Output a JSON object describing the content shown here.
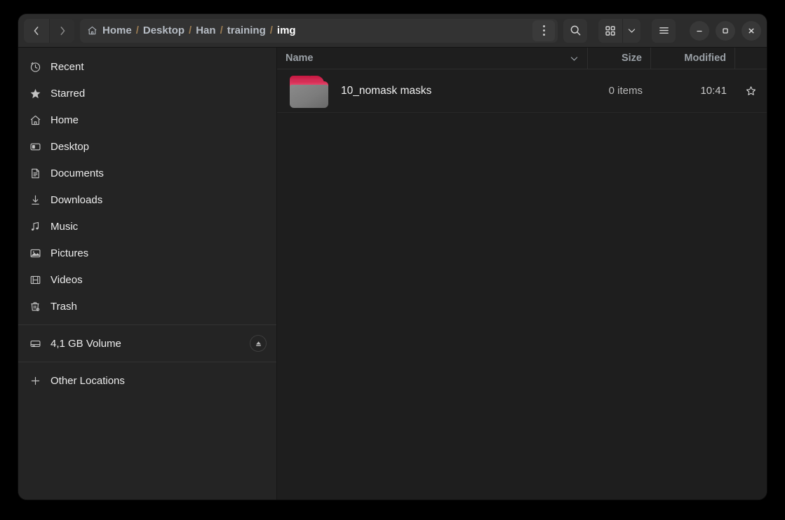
{
  "window": {
    "nav": {
      "back_label": "Back",
      "forward_label": "Forward"
    },
    "pathbar": {
      "crumbs": [
        {
          "label": "Home",
          "icon": "home-icon",
          "current": false
        },
        {
          "label": "Desktop",
          "current": false
        },
        {
          "label": "Han",
          "current": false
        },
        {
          "label": "training",
          "current": false
        },
        {
          "label": "img",
          "current": true
        }
      ],
      "separator": "/",
      "menu_label": "Path options"
    },
    "search_label": "Search",
    "view_label": "Grid view",
    "view_chevron_label": "View options",
    "menu_label": "Main menu",
    "controls": {
      "minimize": "–",
      "maximize": "□",
      "close": "×"
    }
  },
  "sidebar": {
    "items": [
      {
        "label": "Recent",
        "icon": "clock-icon"
      },
      {
        "label": "Starred",
        "icon": "star-icon"
      },
      {
        "label": "Home",
        "icon": "home-icon"
      },
      {
        "label": "Desktop",
        "icon": "desktop-icon"
      },
      {
        "label": "Documents",
        "icon": "document-icon"
      },
      {
        "label": "Downloads",
        "icon": "download-icon"
      },
      {
        "label": "Music",
        "icon": "music-icon"
      },
      {
        "label": "Pictures",
        "icon": "picture-icon"
      },
      {
        "label": "Videos",
        "icon": "video-icon"
      },
      {
        "label": "Trash",
        "icon": "trash-icon"
      }
    ],
    "volume": {
      "label": "4,1 GB Volume",
      "icon": "drive-icon",
      "eject_label": "Eject"
    },
    "other": {
      "label": "Other Locations",
      "icon": "plus-icon"
    }
  },
  "content": {
    "columns": {
      "name": "Name",
      "size": "Size",
      "modified": "Modified"
    },
    "sort": {
      "column": "Name",
      "direction": "descending"
    },
    "rows": [
      {
        "name": "10_nomask masks",
        "size": "0 items",
        "modified": "10:41",
        "icon": "folder-icon",
        "starred": false
      }
    ]
  },
  "colors": {
    "window_bg": "#1e1e1e",
    "headerbar_bg": "#2c2c2c",
    "sidebar_bg": "#242424",
    "folder_accent": "#d62a50",
    "crumb_separator": "#9a7b52"
  }
}
